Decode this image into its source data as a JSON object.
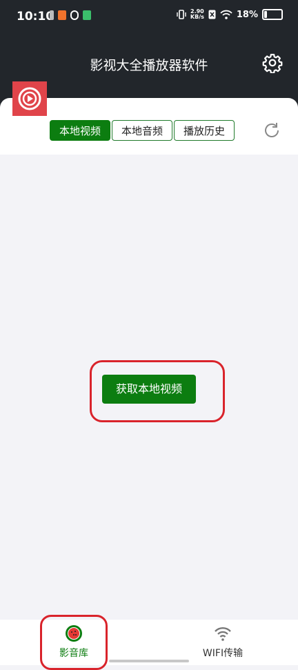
{
  "status_bar": {
    "time": "10:10",
    "net_speed_value": "2.90",
    "net_speed_unit": "KB/s",
    "battery_percent": "18%",
    "battery_level": 0.18
  },
  "header": {
    "title": "影视大全播放器软件",
    "settings_icon": "gear-icon",
    "logo_icon": "video-play-logo"
  },
  "tabs": [
    {
      "label": "本地视频",
      "active": true
    },
    {
      "label": "本地音频",
      "active": false
    },
    {
      "label": "播放历史",
      "active": false
    }
  ],
  "refresh_icon": "refresh-icon",
  "main": {
    "fetch_button_label": "获取本地视频"
  },
  "bottom_nav": [
    {
      "label": "影音库",
      "icon": "watermelon-icon",
      "active": true
    },
    {
      "label": "WIFI传输",
      "icon": "wifi-icon",
      "active": false
    }
  ],
  "colors": {
    "accent": "#0c7d10",
    "header_bg": "#22262b",
    "logo_bg": "#e0444a",
    "highlight": "#d9232b"
  }
}
